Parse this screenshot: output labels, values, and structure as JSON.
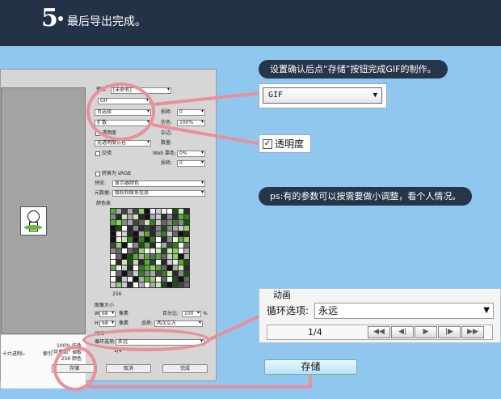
{
  "header": {
    "step_number": "5",
    "title": "最后导出完成。"
  },
  "callouts": {
    "save_tip": "设置确认后点“存储”按钮完成GIF的制作。",
    "params_tip": "ps:有的参数可以按需要做小调整，看个人情况。"
  },
  "zoom": {
    "format_value": "GIF",
    "transparency_label": "透明度",
    "transparency_checked": true,
    "animation": {
      "title": "动画",
      "loop_label": "循环选项:",
      "loop_value": "永远",
      "frame": "1/4",
      "buttons": [
        "◀◀",
        "◀|",
        "▶",
        "|▶",
        "▶▶"
      ]
    },
    "save_label": "存储"
  },
  "dialog": {
    "preset_label": "预设:",
    "preset_value": "[未命名]",
    "format_value": "GIF",
    "reduction_value": "可选择",
    "lossy_label": "损耗:",
    "lossy_value": "0",
    "dither_algo": "扩散",
    "dither_label": "仿色:",
    "dither_value": "100%",
    "transparency_label": "透明度",
    "matte_label": "杂边:",
    "transparency_dither": "无透明度仿色",
    "amount_label": "数量:",
    "interlaced_label": "交错",
    "web_snap_label": "Web 靠色:",
    "web_snap_value": "0%",
    "lossy2_label": "损耗:",
    "lossy2_value": "0",
    "srgb_label": "转换为 sRGB",
    "preview_label": "预览:",
    "preview_value": "显示器颜色",
    "metadata_label": "元数据:",
    "metadata_value": "版权和联系信息",
    "color_table_label": "颜色表",
    "color_count": "256",
    "image_size_label": "图像大小",
    "width_label": "W:",
    "width_value": "68",
    "height_label": "H:",
    "height_value": "68",
    "unit": "像素",
    "percent_label": "百分比:",
    "percent_value": "100",
    "percent_unit": "%",
    "quality_label": "品质:",
    "quality_value": "两次立方",
    "animation_label": "动画",
    "loop_label": "循环选项:",
    "loop_value": "永远",
    "frame": "1/4",
    "save_btn": "存储",
    "cancel_btn": "取消",
    "done_btn": "完成",
    "info_lines": [
      "100% 仿色",
      "\"可感知\" 调板",
      "256 颜色"
    ],
    "hex_label": "十六进制:",
    "hex_value": "--",
    "index_label": "索引:"
  },
  "colors": {
    "header_bg": "#233246",
    "page_bg": "#8fc7ee",
    "highlight_ring": "#e8909c",
    "callout_bg": "#25354a"
  }
}
